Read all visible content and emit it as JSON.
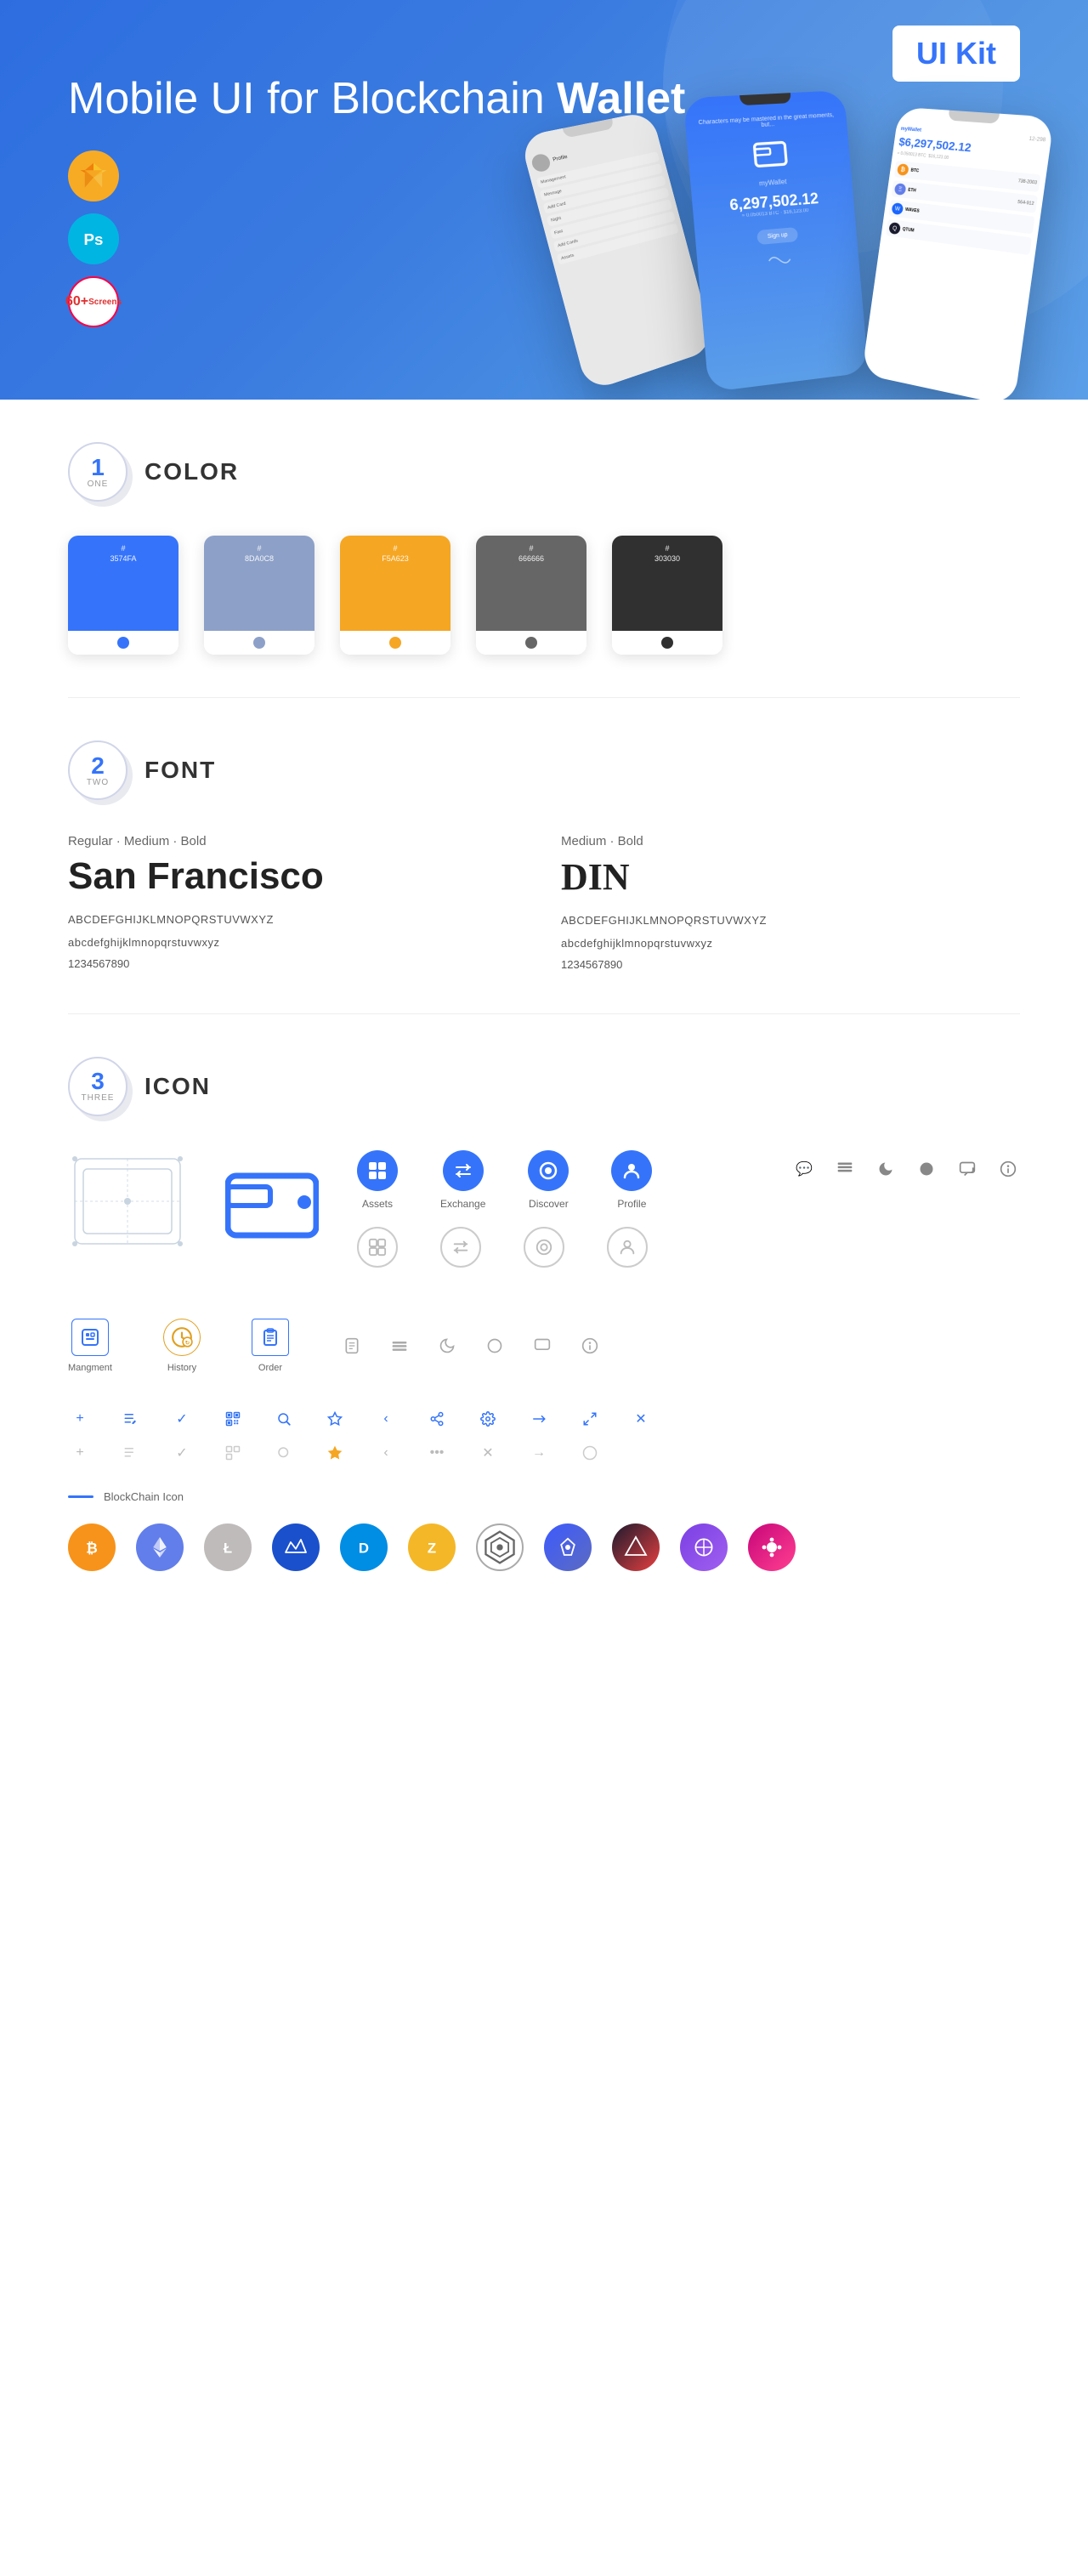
{
  "hero": {
    "title_normal": "Mobile UI for Blockchain ",
    "title_bold": "Wallet",
    "ui_kit_label": "UI Kit",
    "badge_sketch": "S",
    "badge_ps": "Ps",
    "badge_screens_count": "60+",
    "badge_screens_label": "Screens"
  },
  "sections": {
    "color": {
      "number": "1",
      "sub": "ONE",
      "title": "COLOR",
      "swatches": [
        {
          "hex": "#3574FA",
          "code": "#\n3574FA",
          "dark_text": false
        },
        {
          "hex": "#8DA0C8",
          "code": "#\n8DA0C8",
          "dark_text": false
        },
        {
          "hex": "#F5A623",
          "code": "#\nF5A623",
          "dark_text": false
        },
        {
          "hex": "#666666",
          "code": "#\n666666",
          "dark_text": false
        },
        {
          "hex": "#303030",
          "code": "#\n303030",
          "dark_text": false
        }
      ]
    },
    "font": {
      "number": "2",
      "sub": "TWO",
      "title": "FONT",
      "left": {
        "style_label": "Regular · Medium · Bold",
        "font_name": "San Francisco",
        "uppercase": "ABCDEFGHIJKLMNOPQRSTUVWXYZ",
        "lowercase": "abcdefghijklmnopqrstuvwxyz",
        "numbers": "1234567890"
      },
      "right": {
        "style_label": "Medium · Bold",
        "font_name": "DIN",
        "uppercase": "ABCDEFGHIJKLMNOPQRSTUVWXYZ",
        "lowercase": "abcdefghijklmnopqrstuvwxyz",
        "numbers": "1234567890"
      }
    },
    "icon": {
      "number": "3",
      "sub": "THREE",
      "title": "ICON",
      "nav_items": [
        {
          "label": "Assets"
        },
        {
          "label": "Exchange"
        },
        {
          "label": "Discover"
        },
        {
          "label": "Profile"
        }
      ],
      "bottom_icons": [
        {
          "label": "Mangment"
        },
        {
          "label": "History"
        },
        {
          "label": "Order"
        }
      ],
      "blockchain_label": "BlockChain Icon",
      "crypto_coins": [
        {
          "name": "Bitcoin",
          "symbol": "₿"
        },
        {
          "name": "Ethereum",
          "symbol": "Ξ"
        },
        {
          "name": "Litecoin",
          "symbol": "Ł"
        },
        {
          "name": "Waves",
          "symbol": "W"
        },
        {
          "name": "Dash",
          "symbol": "D"
        },
        {
          "name": "Zcash",
          "symbol": "Z"
        },
        {
          "name": "Grid+",
          "symbol": "⬡"
        },
        {
          "name": "Lisk",
          "symbol": "L"
        },
        {
          "name": "Ark",
          "symbol": "Δ"
        },
        {
          "name": "Matic",
          "symbol": "M"
        },
        {
          "name": "Polkadot",
          "symbol": "●"
        }
      ]
    }
  }
}
